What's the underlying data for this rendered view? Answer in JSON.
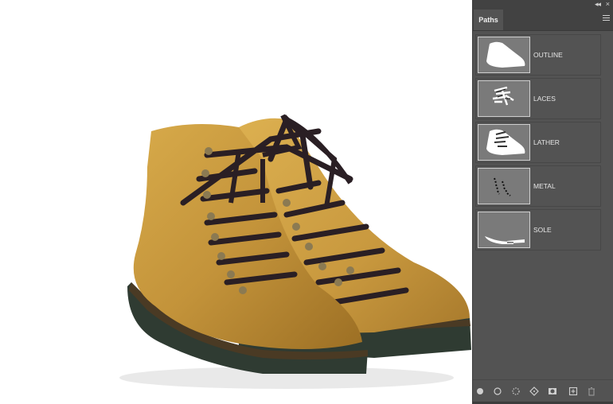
{
  "panel": {
    "tab_label": "Paths",
    "paths": [
      {
        "label": "OUTLINE",
        "icon": "outline-thumbnail"
      },
      {
        "label": "LACES",
        "icon": "laces-thumbnail"
      },
      {
        "label": "LATHER",
        "icon": "lather-thumbnail"
      },
      {
        "label": "METAL",
        "icon": "metal-thumbnail"
      },
      {
        "label": "SOLE",
        "icon": "sole-thumbnail"
      }
    ],
    "bottom_icons": [
      "fill-path-icon",
      "stroke-path-icon",
      "load-selection-icon",
      "make-work-path-icon",
      "add-mask-icon",
      "new-path-icon",
      "delete-path-icon"
    ]
  },
  "colors": {
    "panel_bg": "#535353",
    "panel_dark": "#424242",
    "leather": "#c9993b",
    "lace": "#2a1f24",
    "sole": "#2f3b32"
  }
}
